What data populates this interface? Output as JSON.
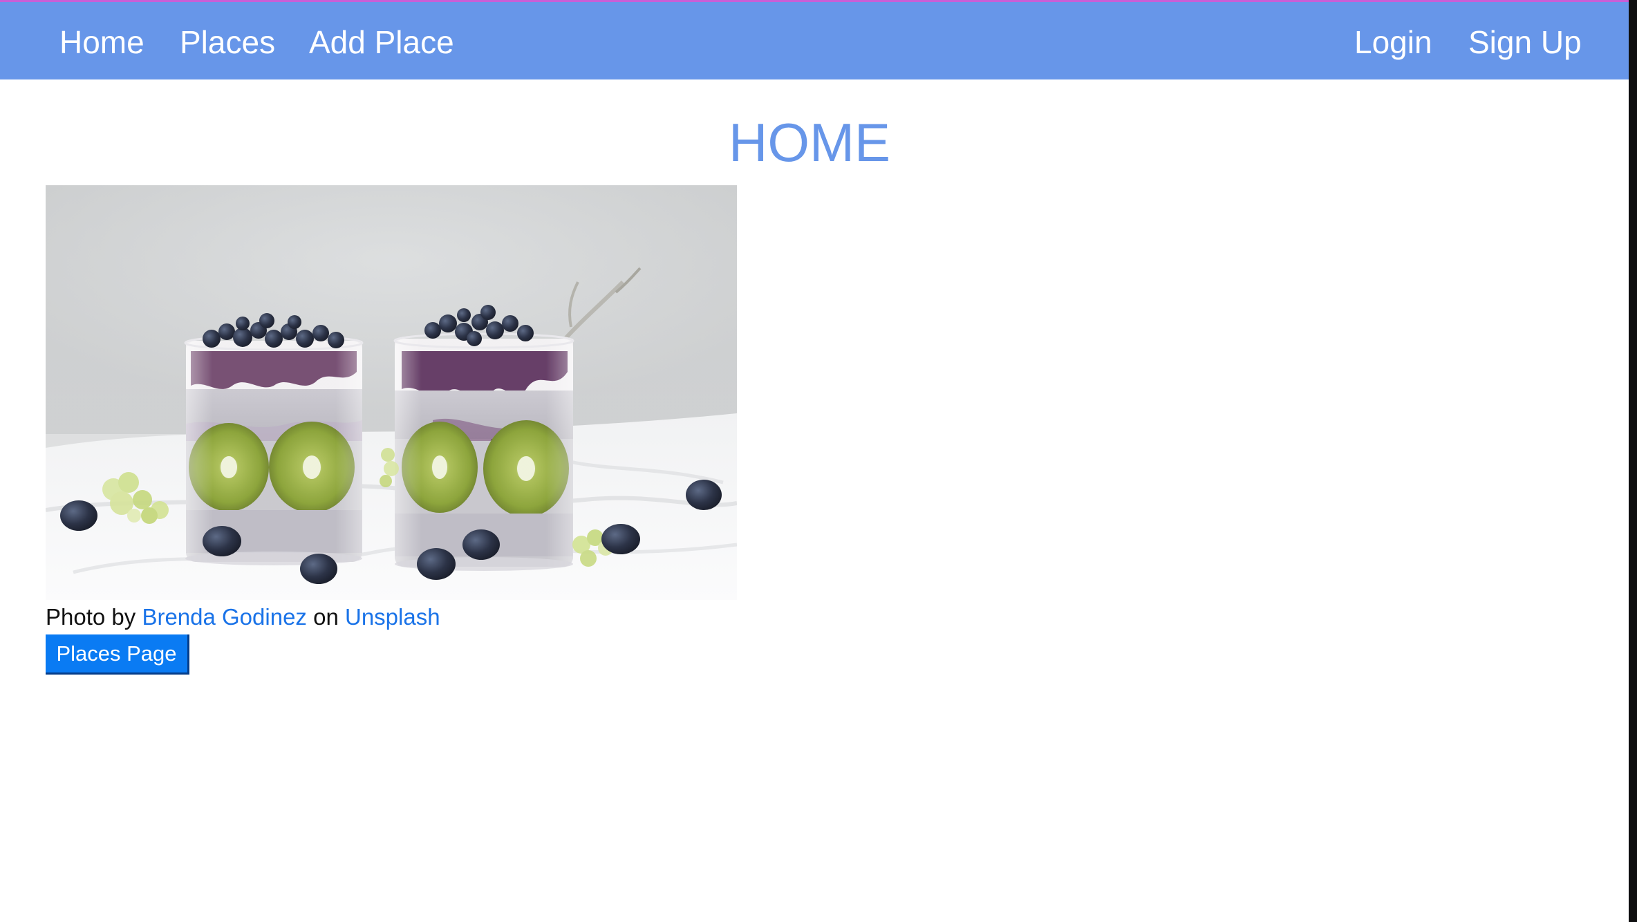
{
  "nav": {
    "home": "Home",
    "places": "Places",
    "add_place": "Add Place",
    "login": "Login",
    "sign_up": "Sign Up"
  },
  "main": {
    "title": "HOME",
    "image_alt": "Chia pudding with kiwi and blueberries",
    "credit": {
      "prefix": "Photo by",
      "author": "Brenda Godinez",
      "middle": "on",
      "site": "Unsplash"
    },
    "button_label": "Places Page"
  },
  "colors": {
    "navbar": "#6796e9",
    "title": "#6796e9",
    "link": "#1a73e8",
    "button": "#0a7bf3"
  },
  "icons": {
    "hero_image": "food-photo"
  }
}
